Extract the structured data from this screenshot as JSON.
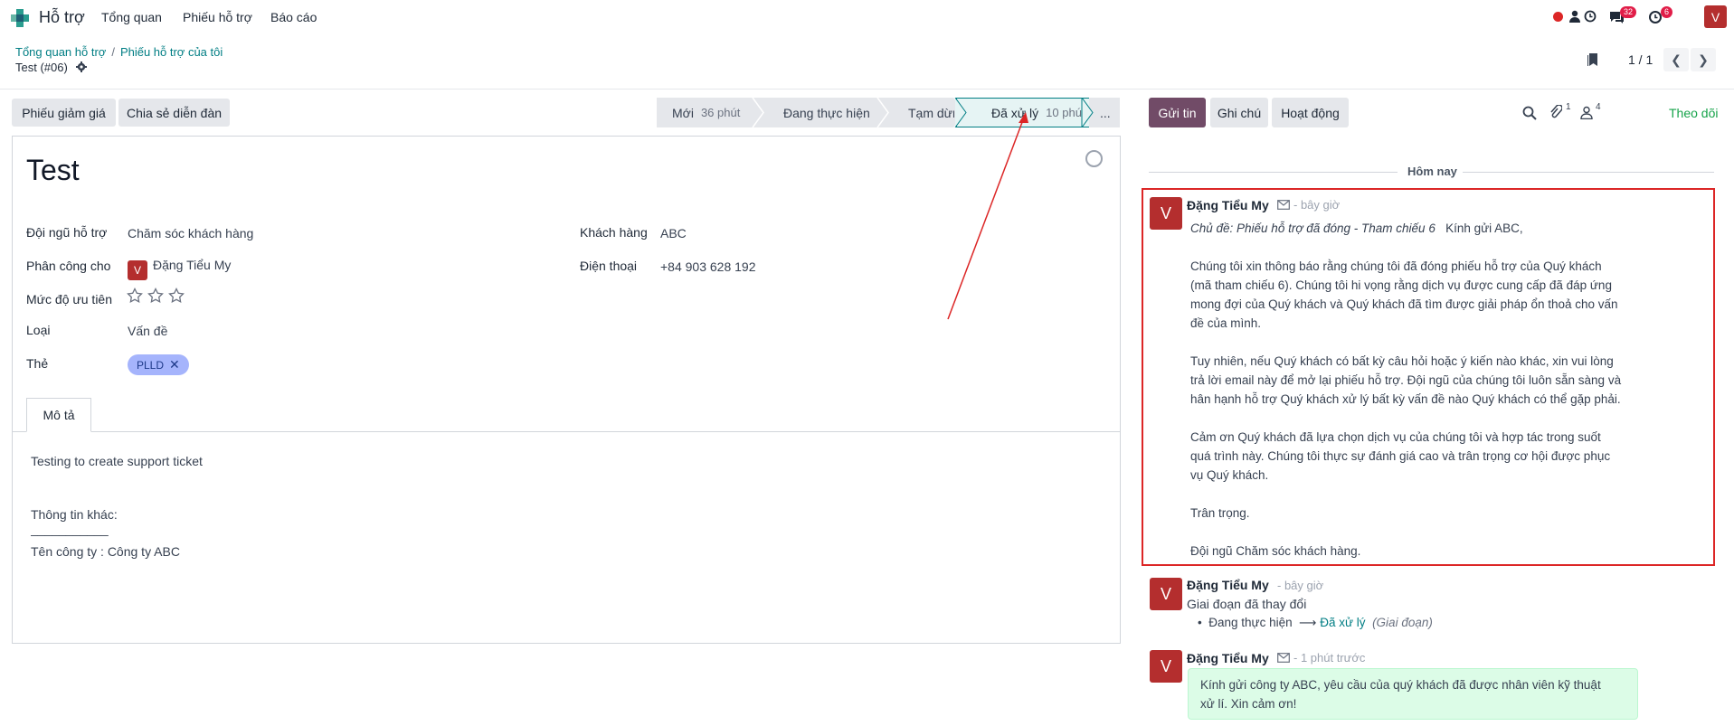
{
  "nav": {
    "app_name": "Hỗ trợ",
    "items": [
      "Tổng quan",
      "Phiếu hỗ trợ",
      "Báo cáo"
    ],
    "chat_count": "32",
    "activity_count": "6",
    "user_initial": "V"
  },
  "breadcrumb": {
    "parent1": "Tổng quan hỗ trợ",
    "separator": "/",
    "parent2": "Phiếu hỗ trợ của tôi",
    "current": "Test (#06)"
  },
  "pager": {
    "value": "1 / 1"
  },
  "actions": [
    "Phiếu giảm giá",
    "Chia sẻ diễn đàn"
  ],
  "stages": [
    {
      "name": "Mới",
      "duration": "36 phút"
    },
    {
      "name": "Đang thực hiện",
      "duration": ""
    },
    {
      "name": "Tạm dừng",
      "duration": ""
    },
    {
      "name": "Đã xử lý",
      "duration": "10 phút"
    },
    {
      "name": "...",
      "duration": ""
    }
  ],
  "form": {
    "title": "Test",
    "team_label": "Đội ngũ hỗ trợ",
    "team_value": "Chăm sóc khách hàng",
    "assign_label": "Phân công cho",
    "assign_initial": "V",
    "assign_value": "Đặng Tiểu My",
    "priority_label": "Mức độ ưu tiên",
    "type_label": "Loại",
    "type_value": "Vấn đề",
    "tags_label": "Thẻ",
    "tag_value": "PLLD",
    "customer_label": "Khách hàng",
    "customer_value": "ABC",
    "phone_label": "Điện thoại",
    "phone_value": "+84 903 628 192",
    "tab_label": "Mô tả",
    "desc_line1": "Testing to create support ticket",
    "desc_line2": "Thông tin khác:",
    "desc_line3": "___________",
    "desc_line4": "Tên công ty : Công ty ABC"
  },
  "chatter": {
    "send_label": "Gửi tin",
    "note_label": "Ghi chú",
    "activity_label": "Hoạt động",
    "attach_count": "1",
    "follower_count": "4",
    "follow_label": "Theo dõi",
    "today_label": "Hôm nay",
    "messages": [
      {
        "initial": "V",
        "author": "Đặng Tiểu My",
        "time": "- bây giờ",
        "subject": "Chủ đề: Phiếu hỗ trợ đã đóng - Tham chiếu 6",
        "greeting": "Kính gửi ABC,",
        "p1_l1": "Chúng tôi xin thông báo rằng chúng tôi đã đóng phiếu hỗ trợ của Quý khách",
        "p1_l2": "(mã tham chiếu 6). Chúng tôi hi vọng rằng dịch vụ được cung cấp đã đáp ứng",
        "p1_l3": "mong đợi của Quý khách và Quý khách đã tìm được giải pháp ổn thoả cho vấn",
        "p1_l4": "đề của mình.",
        "p2_l1": "Tuy nhiên, nếu Quý khách có bất kỳ câu hỏi hoặc ý kiến nào khác, xin vui lòng",
        "p2_l2": "trả lời email này để mở lại phiếu hỗ trợ. Đội ngũ của chúng tôi luôn sẵn sàng và",
        "p2_l3": "hân hạnh hỗ trợ Quý khách xử lý bất kỳ vấn đề nào Quý khách có thể gặp phải.",
        "p3_l1": "Cảm ơn Quý khách đã lựa chọn dịch vụ của chúng tôi và hợp tác trong suốt",
        "p3_l2": "quá trình này. Chúng tôi thực sự đánh giá cao và trân trọng cơ hội được phục",
        "p3_l3": "vụ Quý khách.",
        "regards": "Trân trọng.",
        "signature": "Đội ngũ Chăm sóc khách hàng."
      },
      {
        "initial": "V",
        "author": "Đặng Tiểu My",
        "time": "- bây giờ",
        "text": "Giai đoạn đã thay đổi",
        "old_stage": "Đang thực hiện",
        "new_stage": "Đã xử lý",
        "field": "(Giai đoạn)"
      },
      {
        "initial": "V",
        "author": "Đặng Tiểu My",
        "time": "- 1 phút trước",
        "line1": "Kính gửi công ty ABC, yêu cầu của quý khách đã được nhân viên kỹ thuật",
        "line2": "xử lí. Xin cảm ơn!"
      }
    ]
  },
  "colors": {
    "accent": "#017e84",
    "primary_button": "#714b67",
    "avatar": "#b42e2e",
    "highlight": "#dc2626",
    "active_stage": "#e0f2f1"
  }
}
